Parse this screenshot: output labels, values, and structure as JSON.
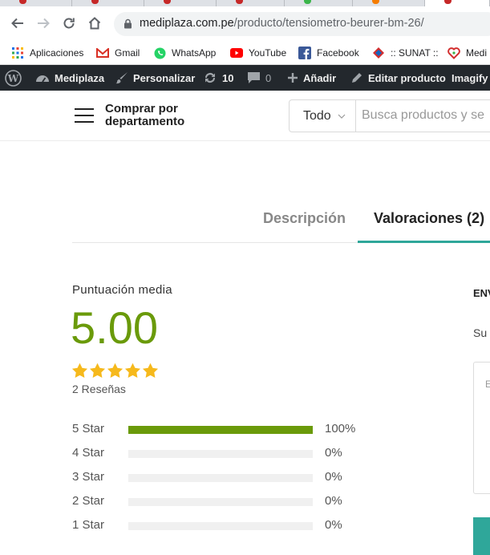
{
  "browser": {
    "url_domain": "mediplaza.com.pe",
    "url_path": "/producto/tensiometro-beurer-bm-26/",
    "bookmarks": [
      {
        "label": "Aplicaciones",
        "icon": "apps-grid-icon"
      },
      {
        "label": "Gmail",
        "icon": "gmail-icon"
      },
      {
        "label": "WhatsApp",
        "icon": "whatsapp-icon"
      },
      {
        "label": "YouTube",
        "icon": "youtube-icon"
      },
      {
        "label": "Facebook",
        "icon": "facebook-icon"
      },
      {
        "label": ":: SUNAT ::",
        "icon": "sunat-icon"
      },
      {
        "label": "Medi",
        "icon": "mediplaza-icon"
      }
    ]
  },
  "adminbar": {
    "site_name": "Mediplaza",
    "customize": "Personalizar",
    "updates_count": "10",
    "comments_count": "0",
    "add_new": "Añadir",
    "edit_product": "Editar producto",
    "imagify": "Imagify"
  },
  "header": {
    "departments_line1": "Comprar por",
    "departments_line2": "departamento",
    "search_category": "Todo",
    "search_placeholder": "Busca productos y se"
  },
  "tabs": [
    {
      "label": "Descripción",
      "active": false
    },
    {
      "label": "Valoraciones (2)",
      "active": true
    }
  ],
  "reviews": {
    "average_label": "Puntuación media",
    "average_score": "5.00",
    "stars_filled": 5,
    "count_label": "2 Reseñas",
    "breakdown": [
      {
        "label": "5 Star",
        "percent_label": "100%",
        "fraction": 1.0
      },
      {
        "label": "4 Star",
        "percent_label": "0%",
        "fraction": 0
      },
      {
        "label": "3 Star",
        "percent_label": "0%",
        "fraction": 0
      },
      {
        "label": "2 Star",
        "percent_label": "0%",
        "fraction": 0
      },
      {
        "label": "1 Star",
        "percent_label": "0%",
        "fraction": 0
      }
    ]
  },
  "review_form": {
    "title": "ENV",
    "subtitle": "Su",
    "field_hint": "E"
  },
  "colors": {
    "accent_teal": "#2fa79a",
    "rating_green": "#6a9a0a",
    "star_yellow": "#f6b91c",
    "admin_bar": "#23282d"
  }
}
